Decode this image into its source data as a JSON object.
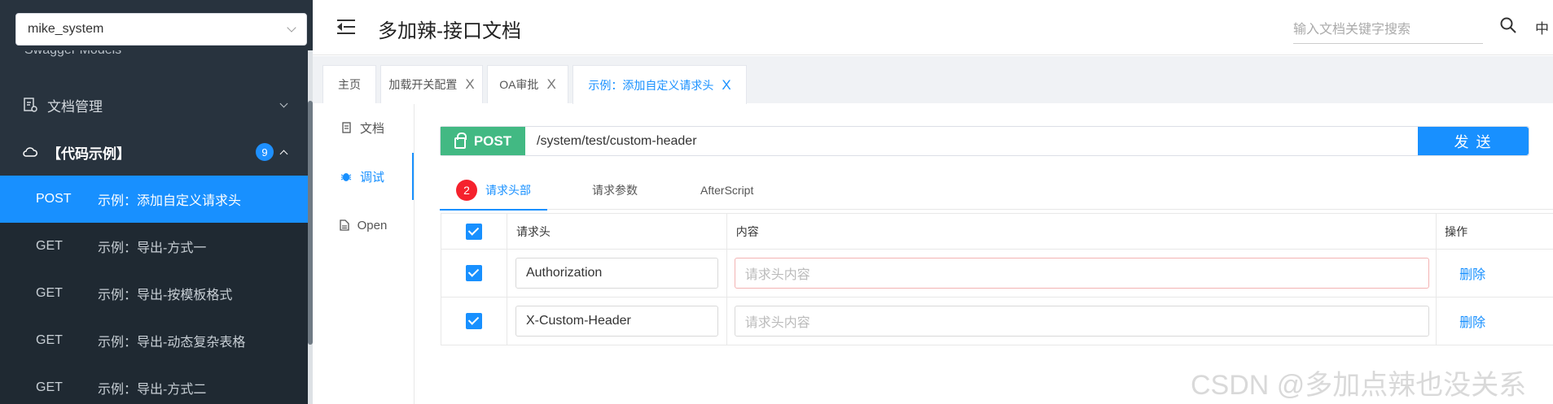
{
  "sidebar": {
    "project_select": "mike_system",
    "cut_item": "Swagger Models",
    "groups": [
      {
        "label": "文档管理"
      },
      {
        "label": "【代码示例】",
        "badge": "9"
      }
    ],
    "apis": [
      {
        "method": "POST",
        "label": "示例：添加自定义请求头",
        "active": true
      },
      {
        "method": "GET",
        "label": "示例：导出-方式一"
      },
      {
        "method": "GET",
        "label": "示例：导出-按模板格式"
      },
      {
        "method": "GET",
        "label": "示例：导出-动态复杂表格"
      },
      {
        "method": "GET",
        "label": "示例：导出-方式二"
      }
    ]
  },
  "header": {
    "title": "多加辣-接口文档",
    "search_placeholder": "输入文档关键字搜索",
    "lang": "中"
  },
  "tabs": [
    {
      "label": "主页"
    },
    {
      "label": "加载开关配置",
      "close": "X"
    },
    {
      "label": "OA审批",
      "close": "X"
    },
    {
      "label": "示例：添加自定义请求头",
      "close": "X",
      "active": true
    }
  ],
  "vnav": [
    {
      "label": "文档"
    },
    {
      "label": "调试",
      "active": true
    },
    {
      "label": "Open"
    }
  ],
  "request": {
    "method": "POST",
    "url": "/system/test/custom-header",
    "send_label": "发 送"
  },
  "subtabs": [
    {
      "label": "请求头部",
      "count": "2",
      "active": true
    },
    {
      "label": "请求参数"
    },
    {
      "label": "AfterScript"
    }
  ],
  "table": {
    "headers": [
      "请求头",
      "内容",
      "操作"
    ],
    "rows": [
      {
        "name": "Authorization",
        "value_placeholder": "请求头内容",
        "action": "删除",
        "checked": true
      },
      {
        "name": "X-Custom-Header",
        "value_placeholder": "请求头内容",
        "action": "删除",
        "checked": true
      }
    ]
  },
  "watermark": "CSDN @多加点辣也没关系",
  "colors": {
    "accent": "#1890ff",
    "post": "#42b983",
    "sidebar": "#28333e"
  }
}
